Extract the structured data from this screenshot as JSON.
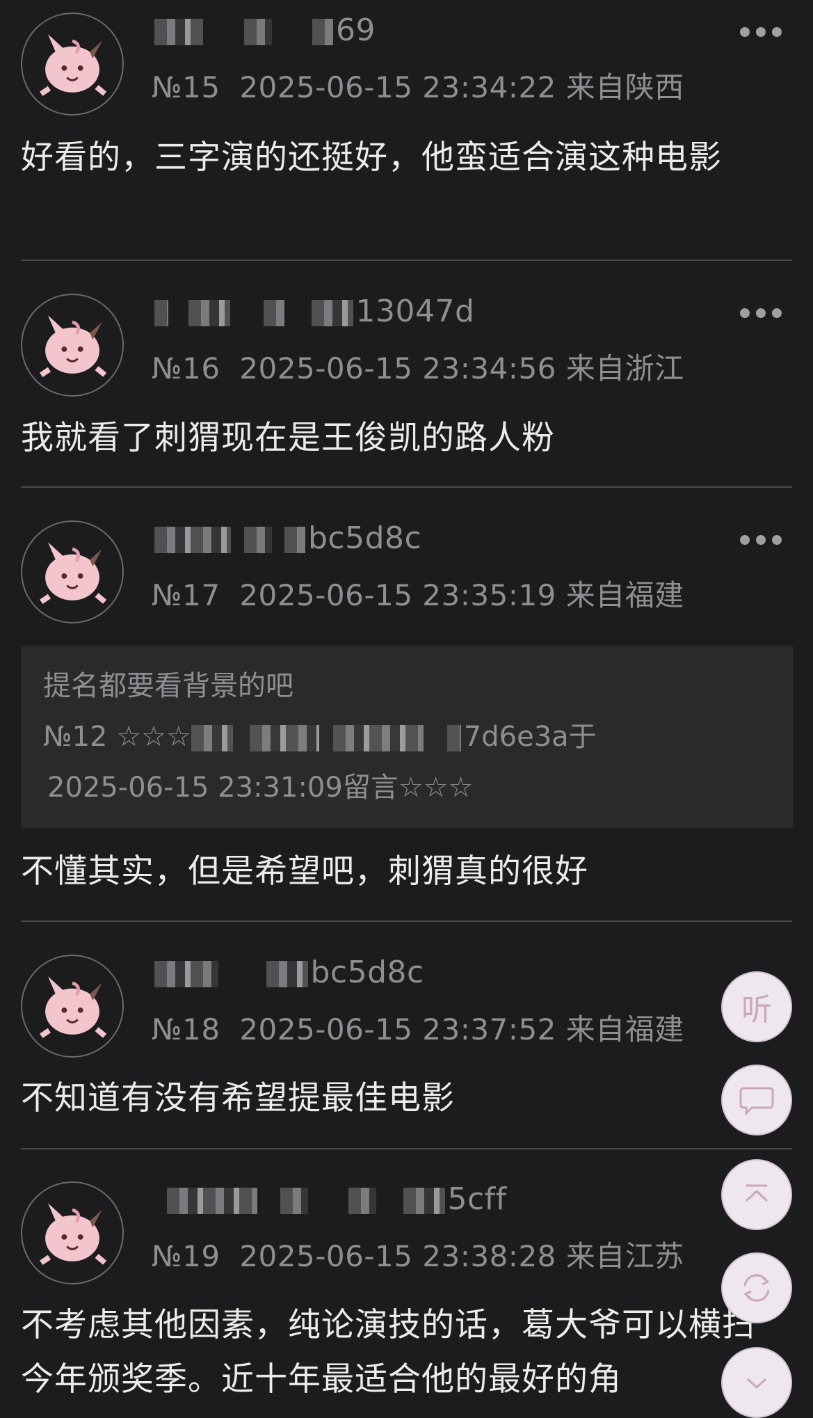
{
  "posts": [
    {
      "username_suffix": "69",
      "floor": "№15",
      "time": "2025-06-15 23:34:22",
      "location": "来自陕西",
      "content": "好看的，三字演的还挺好，他蛮适合演这种电影"
    },
    {
      "username_suffix": "13047d",
      "floor": "№16",
      "time": "2025-06-15 23:34:56",
      "location": "来自浙江",
      "content": "我就看了刺猬现在是王俊凯的路人粉"
    },
    {
      "username_suffix": "bc5d8c",
      "floor": "№17",
      "time": "2025-06-15 23:35:19",
      "location": "来自福建",
      "quote": {
        "text": "提名都要看背景的吧",
        "ref_prefix": "№12 ☆☆☆",
        "ref_suffix": "7d6e3a于",
        "ref_time": "2025-06-15 23:31:09留言☆☆☆"
      },
      "content": "不懂其实，但是希望吧，刺猬真的很好"
    },
    {
      "username_suffix": "bc5d8c",
      "floor": "№18",
      "time": "2025-06-15 23:37:52",
      "location": "来自福建",
      "content": "不知道有没有希望提最佳电影"
    },
    {
      "username_suffix": "5cff",
      "floor": "№19",
      "time": "2025-06-15 23:38:28",
      "location": "来自江苏",
      "content": "不考虑其他因素，纯论演技的话，葛大爷可以横扫今年颁奖季。近十年最适合他的最好的角"
    }
  ],
  "fabs": {
    "listen_label": "听",
    "comment_icon": "comment-bubble-icon",
    "top_icon": "back-to-top-icon",
    "refresh_icon": "refresh-arrows-icon"
  }
}
